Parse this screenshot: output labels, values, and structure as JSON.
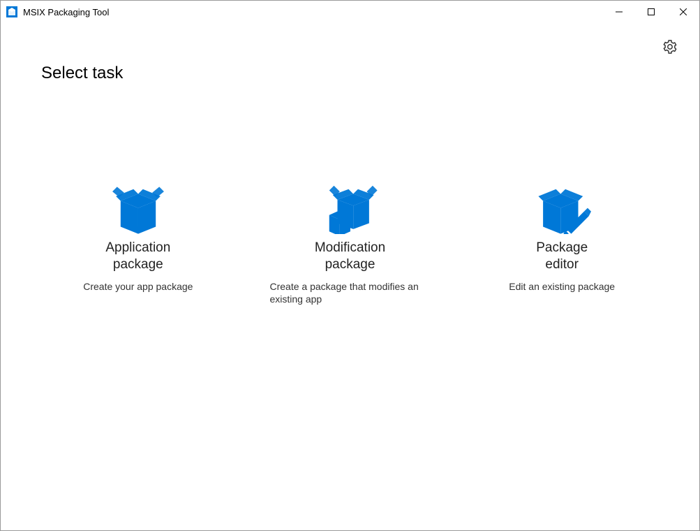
{
  "window": {
    "title": "MSIX Packaging Tool"
  },
  "page": {
    "heading": "Select task"
  },
  "tasks": {
    "app": {
      "title": "Application\npackage",
      "desc": "Create your app package"
    },
    "mod": {
      "title": "Modification\npackage",
      "desc": "Create a package that modifies an existing app"
    },
    "editor": {
      "title": "Package\neditor",
      "desc": "Edit an existing package"
    }
  }
}
